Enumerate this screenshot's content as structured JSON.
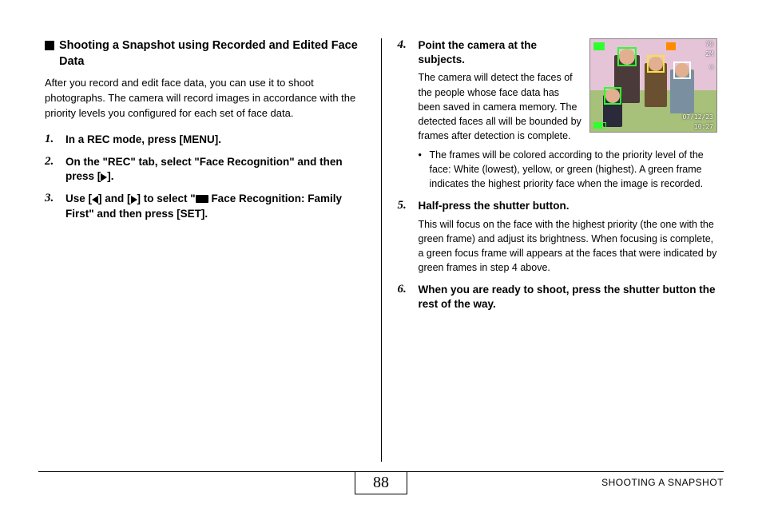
{
  "heading": "Shooting a Snapshot using Recorded and Edited Face Data",
  "intro": "After you record and edit face data, you can use it to shoot photographs. The camera will record images in accordance with the priority levels you configured for each set of face data.",
  "steps": {
    "s1": {
      "num": "1.",
      "title": "In a REC mode, press [MENU]."
    },
    "s2": {
      "num": "2.",
      "title_pre": "On the \"REC\" tab, select \"Face Recognition\" and then press [",
      "title_post": "]."
    },
    "s3": {
      "num": "3.",
      "title_pre": "Use [",
      "title_mid1": "] and [",
      "title_mid2": "] to select \"",
      "title_mid3": " Face Recognition: Family First\" and then press [SET]."
    },
    "s4": {
      "num": "4.",
      "title": "Point the camera at the subjects.",
      "desc": "The camera will detect the faces of the people whose face data has been saved in camera memory. The detected faces all will be bounded by frames after detection is complete.",
      "note": "The frames will be colored according to the priority level of the face: White (lowest), yellow, or green (highest). A green frame indicates the highest priority face when the image is recorded."
    },
    "s5": {
      "num": "5.",
      "title": "Half-press the shutter button.",
      "desc": "This will focus on the face with the highest priority (the one with the green frame) and adjust its brightness. When focusing is complete, a green focus frame will appears at the faces that were indicated by green frames in step 4 above."
    },
    "s6": {
      "num": "6.",
      "title": "When you are ready to shoot, press the shutter button the rest of the way."
    }
  },
  "thumb": {
    "count": "70",
    "mode": "2M",
    "date": "07/12/23",
    "time": "10:27"
  },
  "footer": {
    "page": "88",
    "title": "SHOOTING A SNAPSHOT"
  }
}
